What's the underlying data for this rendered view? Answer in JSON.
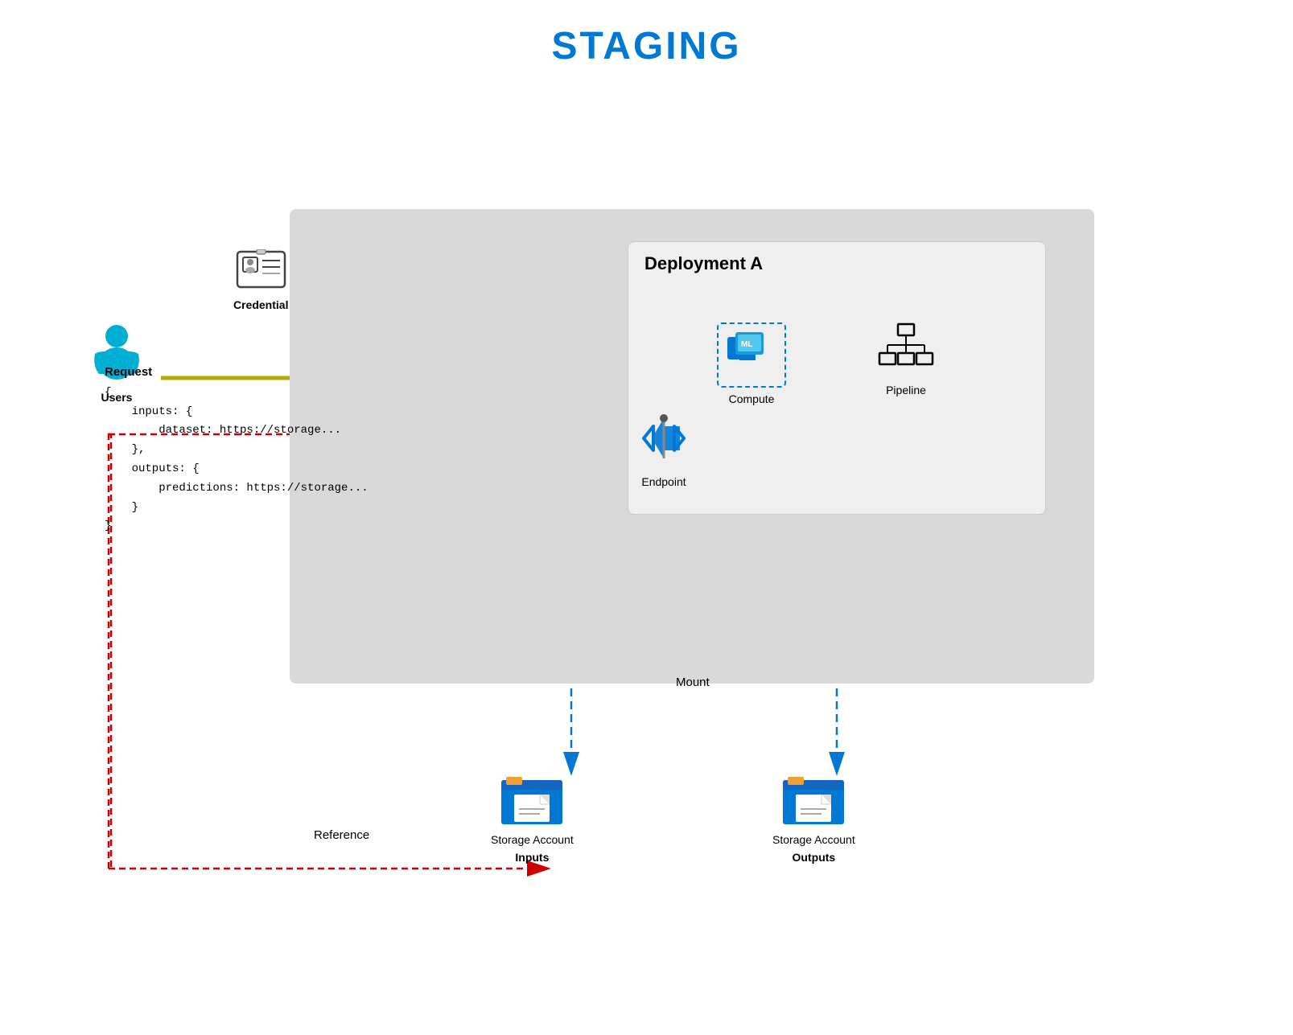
{
  "page": {
    "title": "STAGING",
    "title_color": "#0078d4"
  },
  "diagram": {
    "deployment_title": "Deployment A",
    "users_label": "Users",
    "credential_label": "Credential",
    "endpoint_label": "Endpoint",
    "compute_label": "Compute",
    "pipeline_label": "Pipeline",
    "storage_inputs_label1": "Storage Account",
    "storage_inputs_label2": "Inputs",
    "storage_outputs_label1": "Storage Account",
    "storage_outputs_label2": "Outputs",
    "request_label": "Request",
    "request_code": "{\n    inputs: {\n        dataset: https://storage...\n    },\n    outputs: {\n        predictions: https://storage...\n    }\n}",
    "mount_label": "Mount",
    "reference_label": "Reference"
  }
}
